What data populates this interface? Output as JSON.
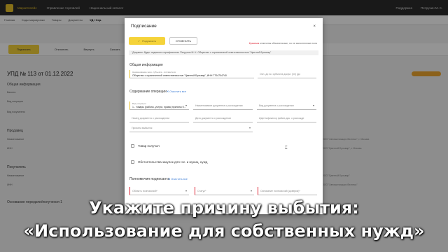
{
  "app": {
    "nav": [
      "Маркетплейс",
      "Управление торговлей",
      "Национальный каталог"
    ],
    "right": [
      "Поддержка",
      "Петрухин М. К."
    ]
  },
  "tabs": [
    "Главная",
    "Коды маркировки",
    "Товары",
    "Документы",
    "УД / Сер."
  ],
  "toolbar": [
    "Подписать",
    "Отклонить",
    "Вернуть",
    "Скачать"
  ],
  "document": {
    "title": "УПД № 113 от 01.12.2022",
    "general": "Общая информация",
    "rows": [
      "Валюта",
      "Вид операции",
      "Вид покупателя"
    ],
    "seller": "Продавец",
    "buyer": "Покупатель",
    "basis": "Основание передачи/получения 1",
    "seller_rows": [
      "Наименование",
      "ИНН"
    ],
    "buyer_rows": [
      "Наименование",
      "ИНН"
    ],
    "right_lines": [
      "ООО \"Автоматизация бизнеса\", г. Москва",
      "ООО \"Цветной Бульвар\", г. Москва",
      "ООО \"Цветной Бульвар\"",
      "ООО \"Автоматизация бизнеса\""
    ]
  },
  "modal": {
    "title": "Подписание",
    "close": "×",
    "sign_label": "Подписать",
    "cancel_label": "ОТМЕНИТЬ",
    "required_red": "Красным",
    "required_rest": " отмечены обязательные, но не заполненные поля",
    "info": "\"Документ будет подписан сертификатом: Петрухин М. К. Общество с ограниченной ответственностью \"Цветной Бульвар\"",
    "general": {
      "title": "Общая информация",
      "org_label": "Наименование экон. субъекта - составителя",
      "org_value": "Общество с ограниченной ответственностью \"Цветной Бульвар\", ИНН 7704704740",
      "basis_ph": "Осн. до эк. субъекта докум. (нн) (до"
    },
    "operation": {
      "title": "Содержание операции",
      "clear": "Очистить все",
      "type_label": "Вид операции",
      "type_value": "1 - товары (работы, услуги, права) приняты б...",
      "doc_name_ph": "Наименование документа о расхождении",
      "doc_kind_ph": "Вид документа о расхождении",
      "doc_num_ph": "Номер документа о расхождении",
      "doc_date_ph": "Дата документа о расхождении",
      "doc_id_ph": "Идентификатор файла док. о расхожде",
      "reason_ph": "Причина выбытия"
    },
    "goods_received": "Товар получил",
    "circumstances": "Обстоятельства закупок для гос. и муниц. нужд",
    "signer": {
      "title": "Полномочия подписанта",
      "clear": "Очистить все",
      "scope_ph": "Область полномочий*",
      "status_ph": "Статус*",
      "basis_ph": "Основание полномочий (доверия)*"
    }
  },
  "caption": {
    "line1": "Укажите причину выбытия:",
    "line2": "«Использование для собственных нужд»"
  }
}
